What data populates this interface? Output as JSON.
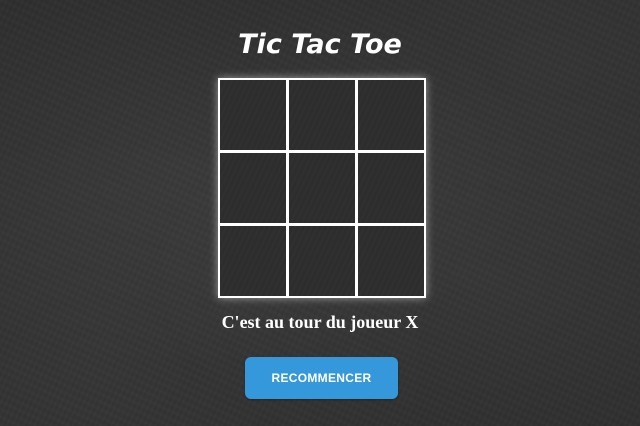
{
  "game": {
    "title": "Tic Tac Toe",
    "status": "C'est au tour du joueur X",
    "current_player": "X",
    "board": [
      "",
      "",
      "",
      "",
      "",
      "",
      "",
      "",
      ""
    ]
  },
  "controls": {
    "restart_label": "RECOMMENCER"
  },
  "colors": {
    "background": "#2f2f2f",
    "grid_lines": "#ffffff",
    "text": "#ffffff",
    "button": "#3598db"
  }
}
